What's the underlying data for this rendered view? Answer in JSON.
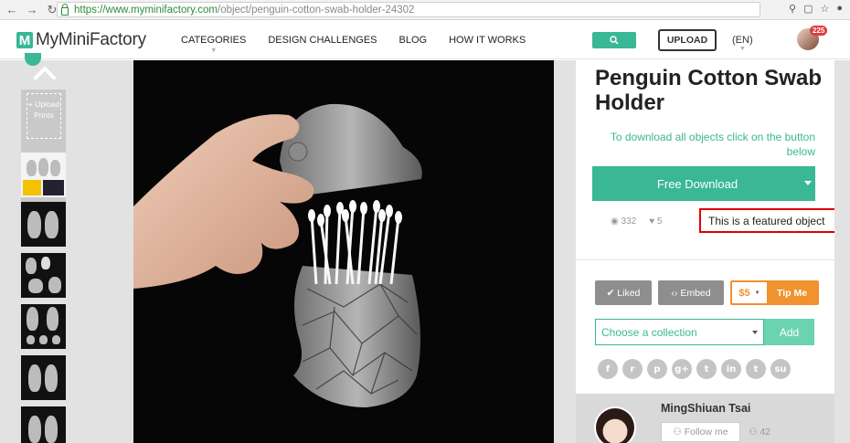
{
  "browser": {
    "url_secure": "https://www.myminifactory.com",
    "url_path": "/object/penguin-cotton-swab-holder-24302"
  },
  "header": {
    "logo_mark": "M",
    "logo_text": "MyMiniFactory",
    "nav": [
      "CATEGORIES",
      "DESIGN CHALLENGES",
      "BLOG",
      "HOW IT WORKS"
    ],
    "upload_label": "UPLOAD",
    "language": "(EN)",
    "notification_count": "225"
  },
  "thumbs": {
    "upload_label": "+ Upload Prints"
  },
  "object": {
    "title": "Penguin Cotton Swab Holder",
    "download_note": "To download all objects click on the button below",
    "free_download_label": "Free Download",
    "views": "332",
    "likes": "5",
    "featured_text": "This is a featured object"
  },
  "actions": {
    "liked_label": "Liked",
    "embed_label": "Embed",
    "tip_amount": "$5",
    "tip_label": "Tip Me",
    "collection_placeholder": "Choose a collection",
    "add_label": "Add"
  },
  "socials": [
    "facebook",
    "reddit",
    "pinterest",
    "google-plus",
    "twitter",
    "linkedin",
    "tumblr",
    "stumbleupon"
  ],
  "author": {
    "name": "MingShiuan Tsai",
    "follow_label": "Follow me",
    "followers": "42"
  },
  "colors": {
    "accent": "#3ab795",
    "tip": "#f0922e",
    "featured_border": "#e00000"
  }
}
